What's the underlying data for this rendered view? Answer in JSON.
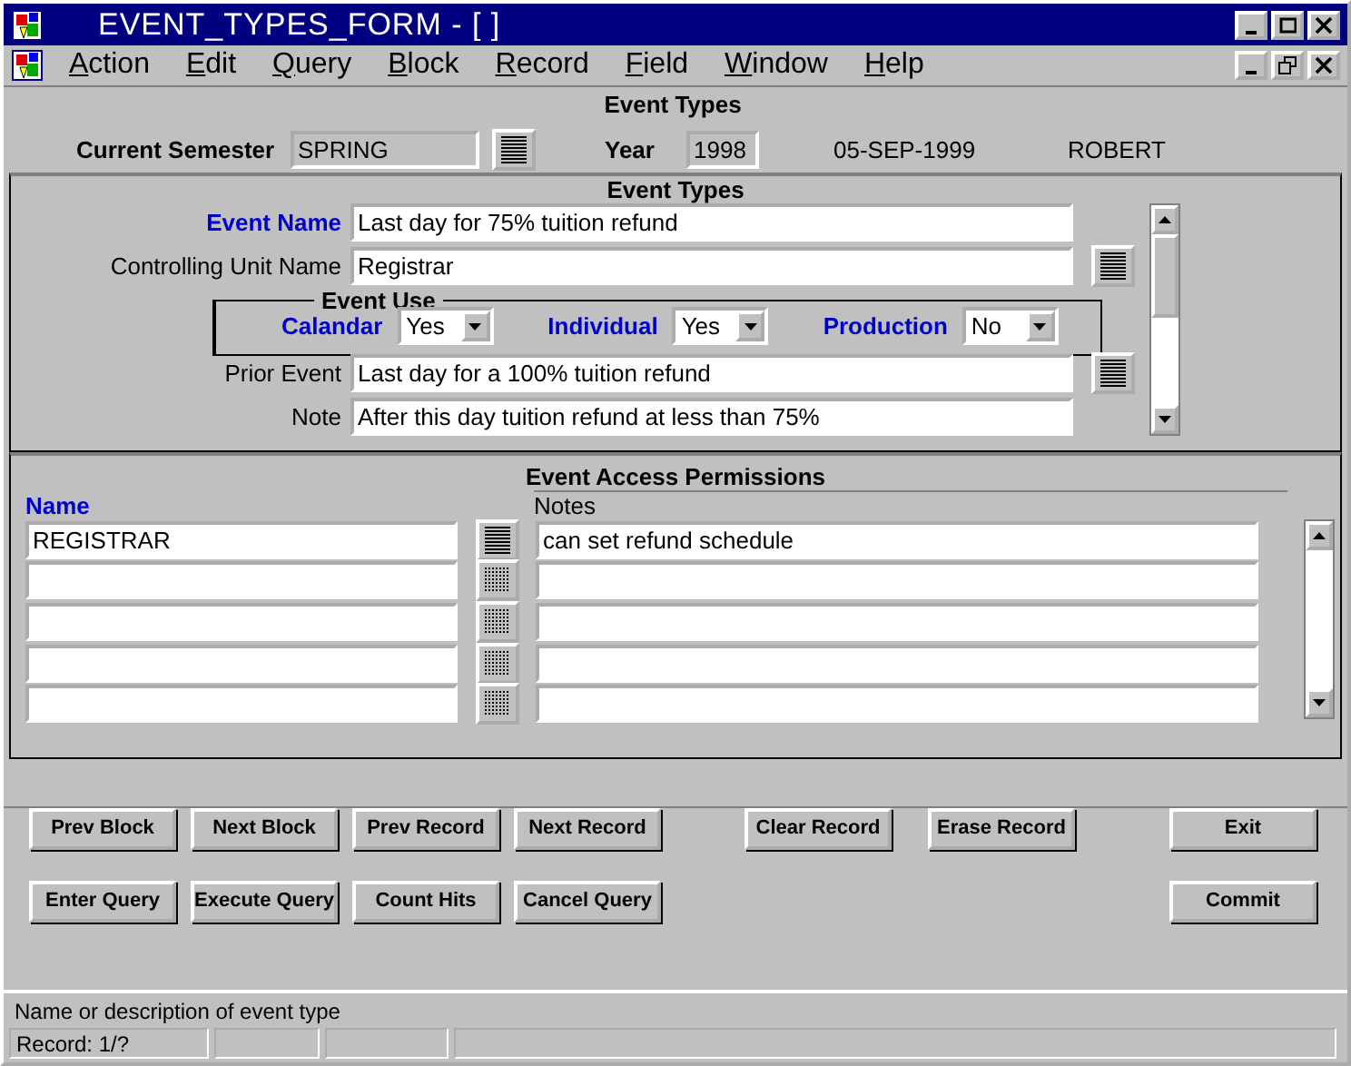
{
  "window": {
    "title": "EVENT_TYPES_FORM - [ ]"
  },
  "menu": [
    "Action",
    "Edit",
    "Query",
    "Block",
    "Record",
    "Field",
    "Window",
    "Help"
  ],
  "header": {
    "title": "Event Types",
    "semester_label": "Current Semester",
    "semester": "SPRING",
    "year_label": "Year",
    "year": "1998",
    "date": "05-SEP-1999",
    "user": "ROBERT"
  },
  "event_types": {
    "title": "Event Types",
    "event_name": {
      "label": "Event Name",
      "value": "Last day for 75% tuition refund",
      "required": true
    },
    "controlling_unit": {
      "label": "Controlling Unit Name",
      "value": "Registrar",
      "required": false
    },
    "event_use": {
      "title": "Event Use",
      "options": [
        {
          "label": "Calandar",
          "value": "Yes"
        },
        {
          "label": "Individual",
          "value": "Yes"
        },
        {
          "label": "Production",
          "value": "No"
        }
      ]
    },
    "prior_event": {
      "label": "Prior Event",
      "value": "Last day for a 100% tuition refund",
      "required": false
    },
    "note": {
      "label": "Note",
      "value": "After this day tuition refund at less than 75%",
      "required": false
    }
  },
  "permissions": {
    "title": "Event Access Permissions",
    "name_label": "Name",
    "notes_label": "Notes",
    "rows": [
      {
        "name": "REGISTRAR",
        "notes": "can set refund schedule",
        "lov_enabled": true
      },
      {
        "lov_enabled": false
      },
      {
        "lov_enabled": false
      },
      {
        "lov_enabled": false
      },
      {
        "lov_enabled": false
      }
    ]
  },
  "buttons": [
    {
      "nav": [
        "Prev Block",
        "Next Block",
        "Prev Record",
        "Next Record"
      ],
      "edit": [
        "Clear Record",
        "Erase Record"
      ],
      "action": [
        "Exit"
      ]
    },
    {
      "nav": [
        "Enter Query",
        "Execute Query",
        "Count Hits",
        "Cancel Query"
      ],
      "action": [
        "Commit"
      ]
    }
  ],
  "status": {
    "message": "Name or description of event type",
    "record": "Record: 1/?"
  }
}
